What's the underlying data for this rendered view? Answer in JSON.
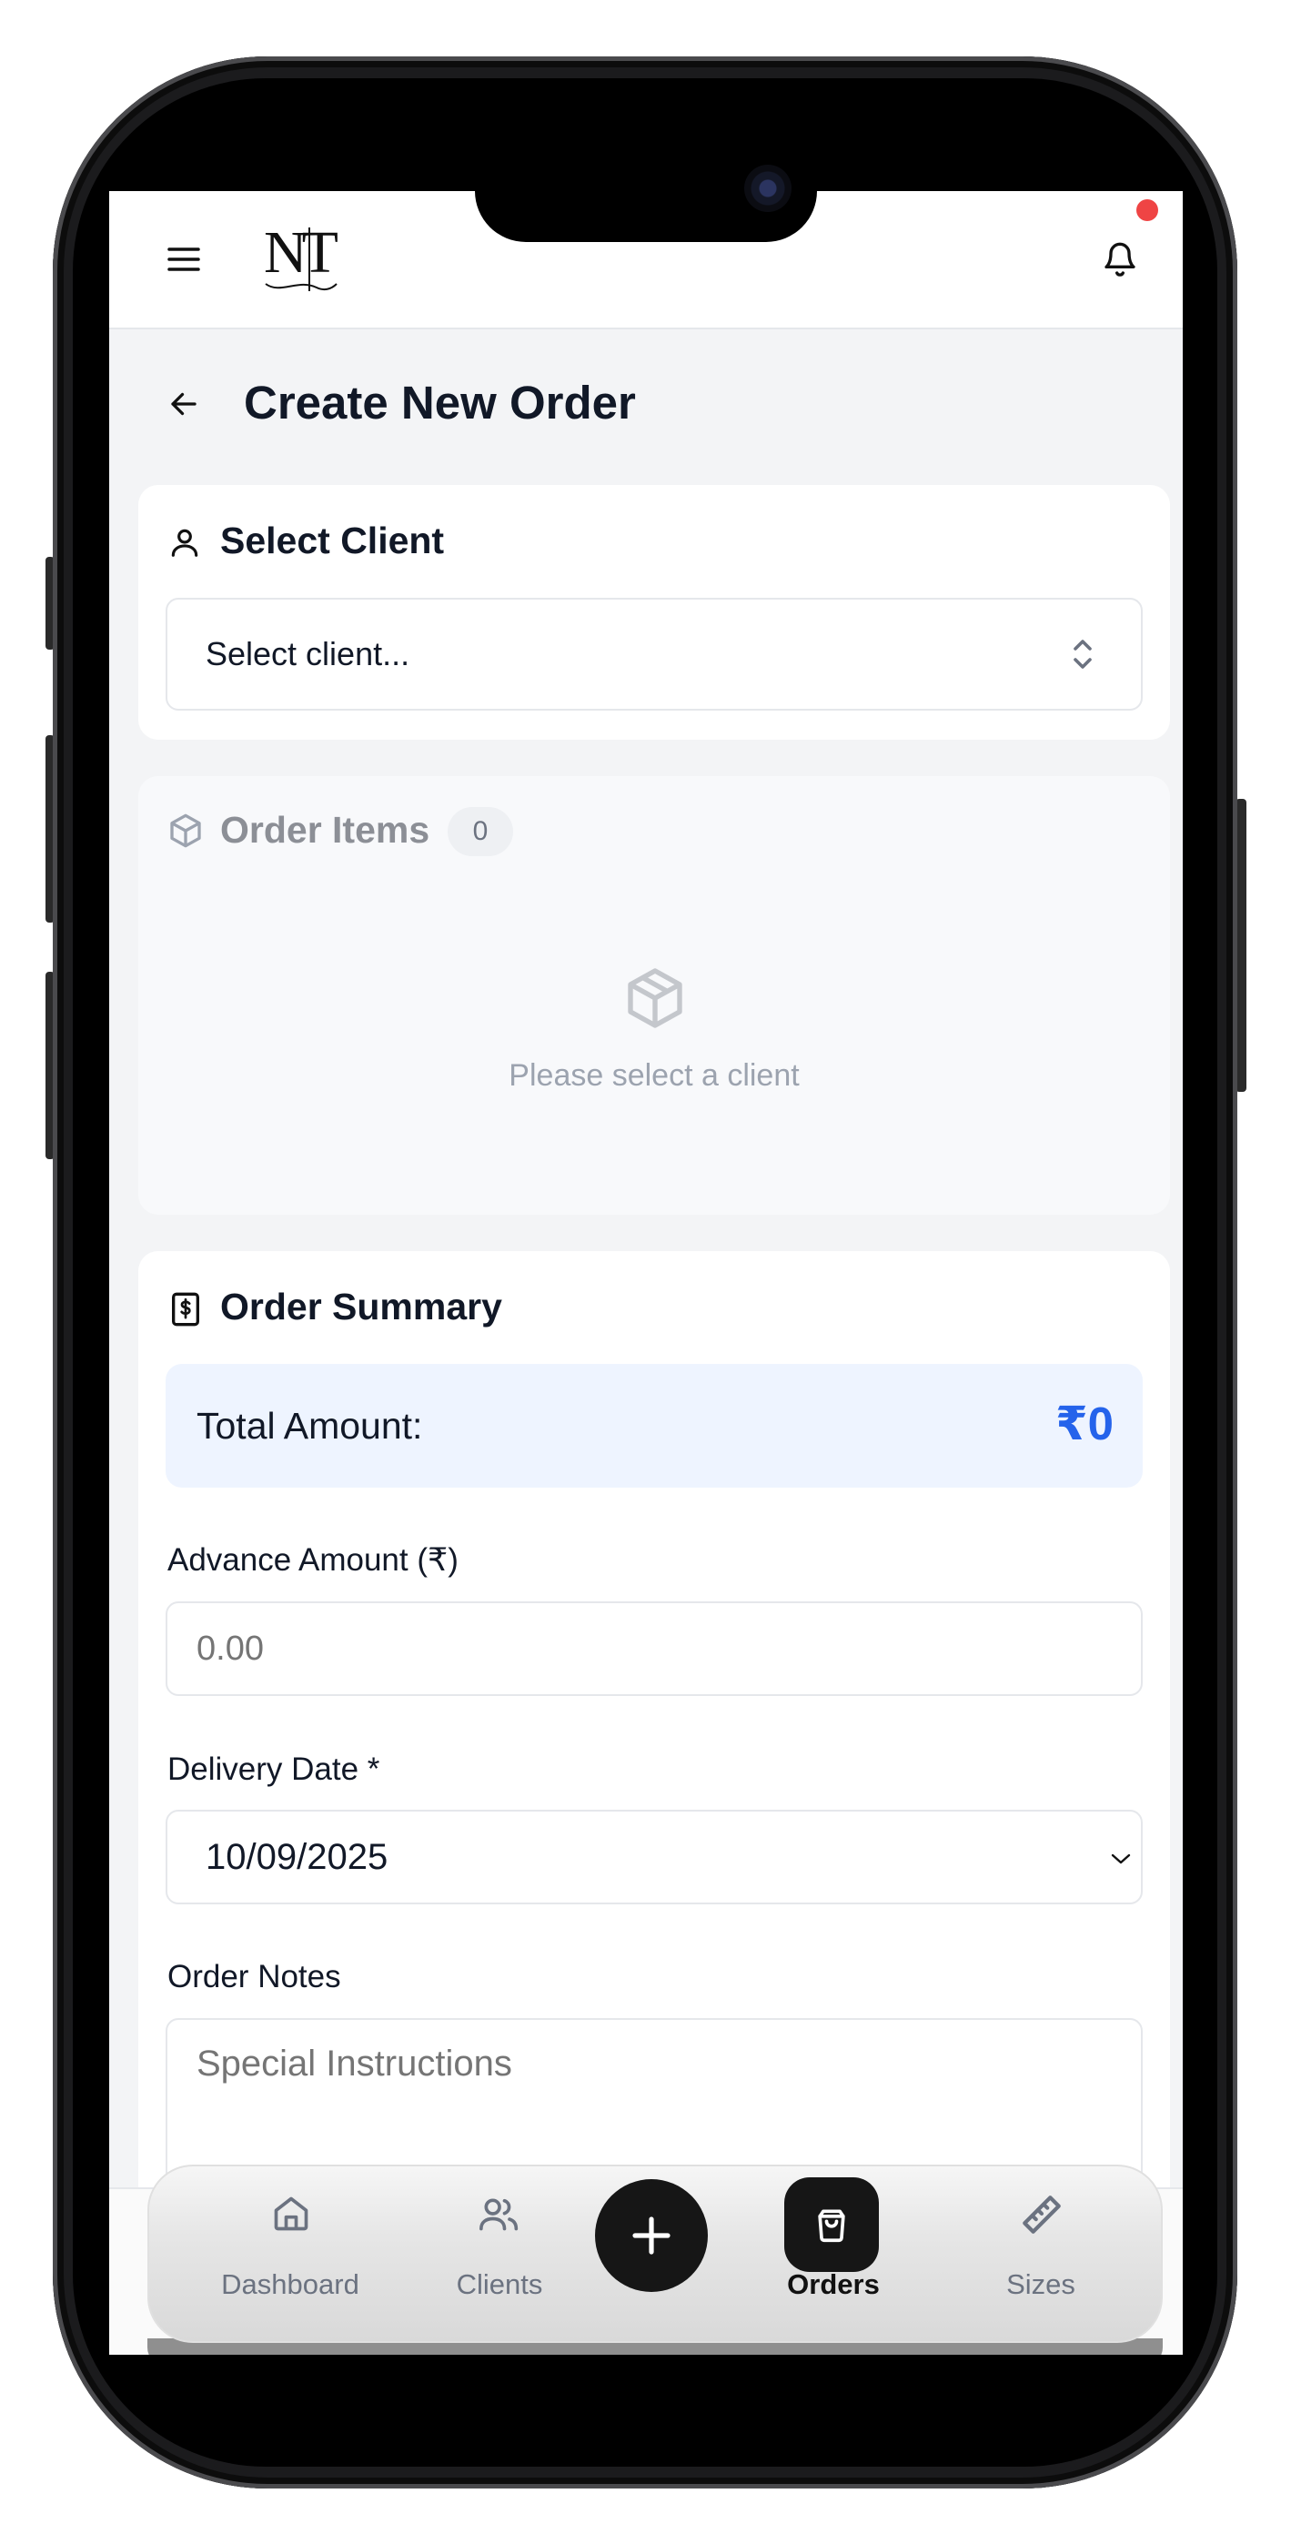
{
  "header": {
    "menu_icon": "hamburger-menu-icon",
    "logo_text": "NT",
    "bell_icon": "bell-icon"
  },
  "page": {
    "title": "Create New Order",
    "back_icon": "arrow-left-icon"
  },
  "select_client": {
    "title": "Select Client",
    "icon": "user-icon",
    "placeholder": "Select client...",
    "chevron_icon": "chevrons-up-down-icon"
  },
  "order_items": {
    "title": "Order Items",
    "icon": "package-icon",
    "count": "0",
    "empty_text": "Please select a client"
  },
  "order_summary": {
    "title": "Order Summary",
    "icon": "receipt-icon",
    "total_label": "Total Amount:",
    "total_value": "₹0",
    "advance_label": "Advance Amount (₹)",
    "advance_placeholder": "0.00",
    "delivery_label": "Delivery Date *",
    "delivery_value": "10/09/2025",
    "notes_label": "Order Notes",
    "notes_placeholder": "Special Instructions"
  },
  "bottom_nav": {
    "items": [
      {
        "label": "Dashboard",
        "icon": "home-icon"
      },
      {
        "label": "Clients",
        "icon": "users-icon"
      },
      {
        "label": "",
        "icon": "plus-icon"
      },
      {
        "label": "Orders",
        "icon": "shopping-bag-icon"
      },
      {
        "label": "Sizes",
        "icon": "ruler-icon"
      }
    ]
  },
  "colors": {
    "accent": "#2563eb",
    "total_bg": "#eef4ff",
    "notification": "#ef4444",
    "nav_active": "#111111"
  }
}
